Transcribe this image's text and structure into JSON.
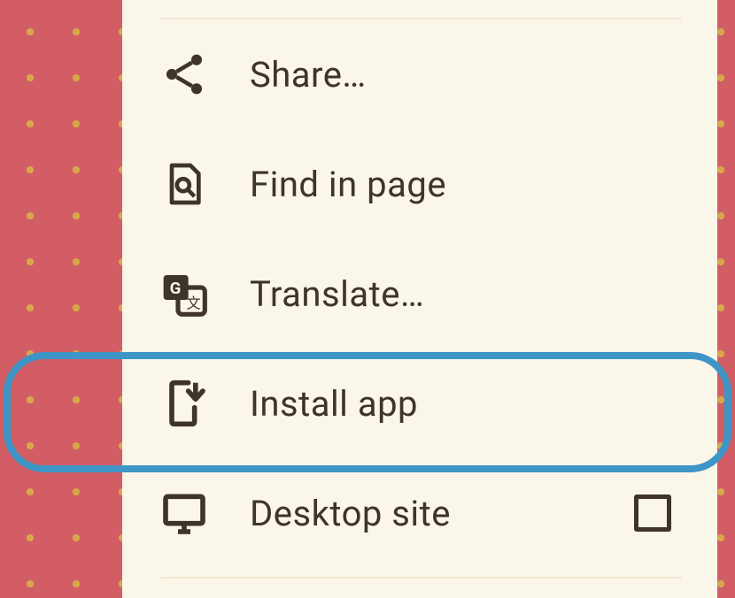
{
  "menu": {
    "items": [
      {
        "key": "share",
        "label": "Share…",
        "icon": "share-icon"
      },
      {
        "key": "find",
        "label": "Find in page",
        "icon": "find-in-page-icon"
      },
      {
        "key": "translate",
        "label": "Translate…",
        "icon": "translate-icon"
      },
      {
        "key": "install",
        "label": "Install app",
        "icon": "install-app-icon",
        "highlighted": true
      },
      {
        "key": "desktop",
        "label": "Desktop site",
        "icon": "desktop-icon",
        "hasCheckbox": true,
        "checked": false
      }
    ]
  },
  "highlight_color": "#3e96c6"
}
